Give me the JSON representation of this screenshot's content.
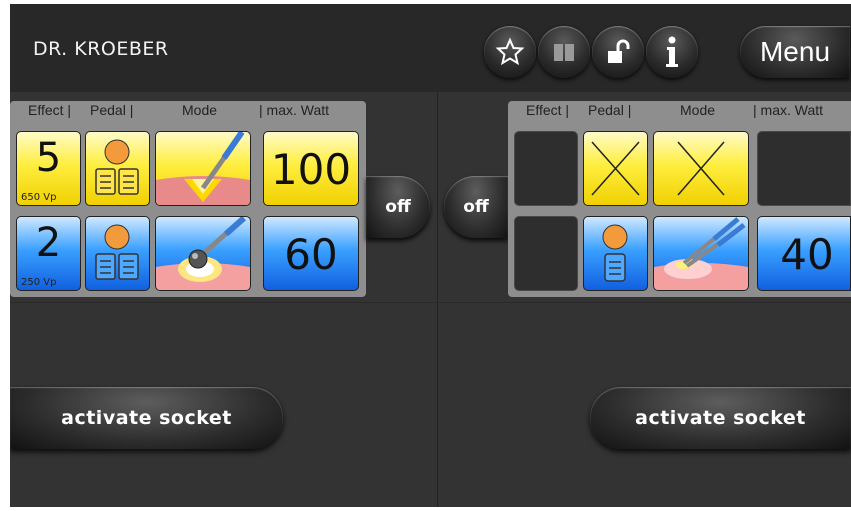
{
  "header": {
    "operator": "DR. KROEBER",
    "menu_label": "Menu",
    "icons": [
      "star-icon",
      "book-icon",
      "unlock-icon",
      "info-icon"
    ]
  },
  "columns": {
    "effect": "Effect |",
    "pedal": "Pedal |",
    "mode": "Mode",
    "watt": "| max. Watt",
    "effect_r": "Effect |",
    "pedal_r": "Pedal |",
    "mode_r": "Mode",
    "watt_r": "| max. Watt"
  },
  "left_socket": {
    "cut": {
      "effect": "5",
      "voltage": "650 Vp",
      "watt": "100",
      "color": "#ffee40"
    },
    "coag": {
      "effect": "2",
      "voltage": "250 Vp",
      "watt": "60",
      "color": "#3aa0ff"
    },
    "off_label": "off",
    "activate_label": "activate socket"
  },
  "right_socket": {
    "coag": {
      "watt": "40",
      "color": "#3aa0ff"
    },
    "off_label": "off",
    "activate_label": "activate socket"
  },
  "colors": {
    "cut": "#ffee40",
    "coag": "#3aa0ff",
    "background": "#333333",
    "topbar": "#282828"
  }
}
